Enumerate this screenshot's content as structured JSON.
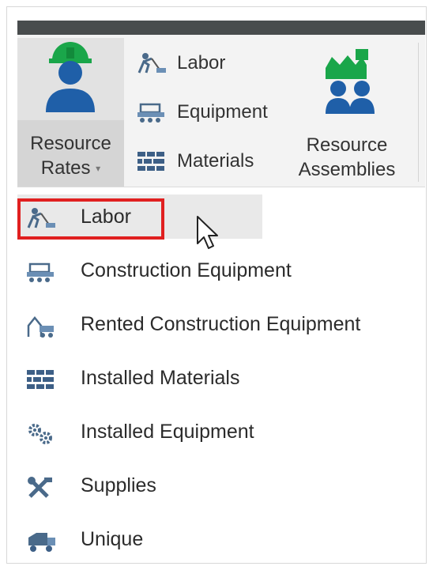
{
  "ribbon": {
    "resource_rates": {
      "label_line1": "Resource",
      "label_line2": "Rates",
      "caret": "▾",
      "icon": "worker-hardhat-icon"
    },
    "items": [
      {
        "label": "Labor",
        "icon": "labor-icon"
      },
      {
        "label": "Equipment",
        "icon": "equipment-icon"
      },
      {
        "label": "Materials",
        "icon": "materials-icon"
      }
    ],
    "resource_assemblies": {
      "label_line1": "Resource",
      "label_line2": "Assemblies",
      "icon": "resource-assemblies-icon"
    }
  },
  "menu": {
    "items": [
      {
        "label": "Labor",
        "icon": "labor-icon",
        "selected": true
      },
      {
        "label": "Construction Equipment",
        "icon": "construction-equipment-icon"
      },
      {
        "label": "Rented Construction Equipment",
        "icon": "rented-equipment-icon"
      },
      {
        "label": "Installed Materials",
        "icon": "installed-materials-icon"
      },
      {
        "label": "Installed Equipment",
        "icon": "gears-icon"
      },
      {
        "label": "Supplies",
        "icon": "supplies-icon"
      },
      {
        "label": "Unique",
        "icon": "truck-icon"
      }
    ]
  },
  "colors": {
    "highlight_border": "#e02020",
    "icon_blue": "#1f5fa8",
    "icon_green": "#1aa64a",
    "titlebar": "#484c4d"
  }
}
